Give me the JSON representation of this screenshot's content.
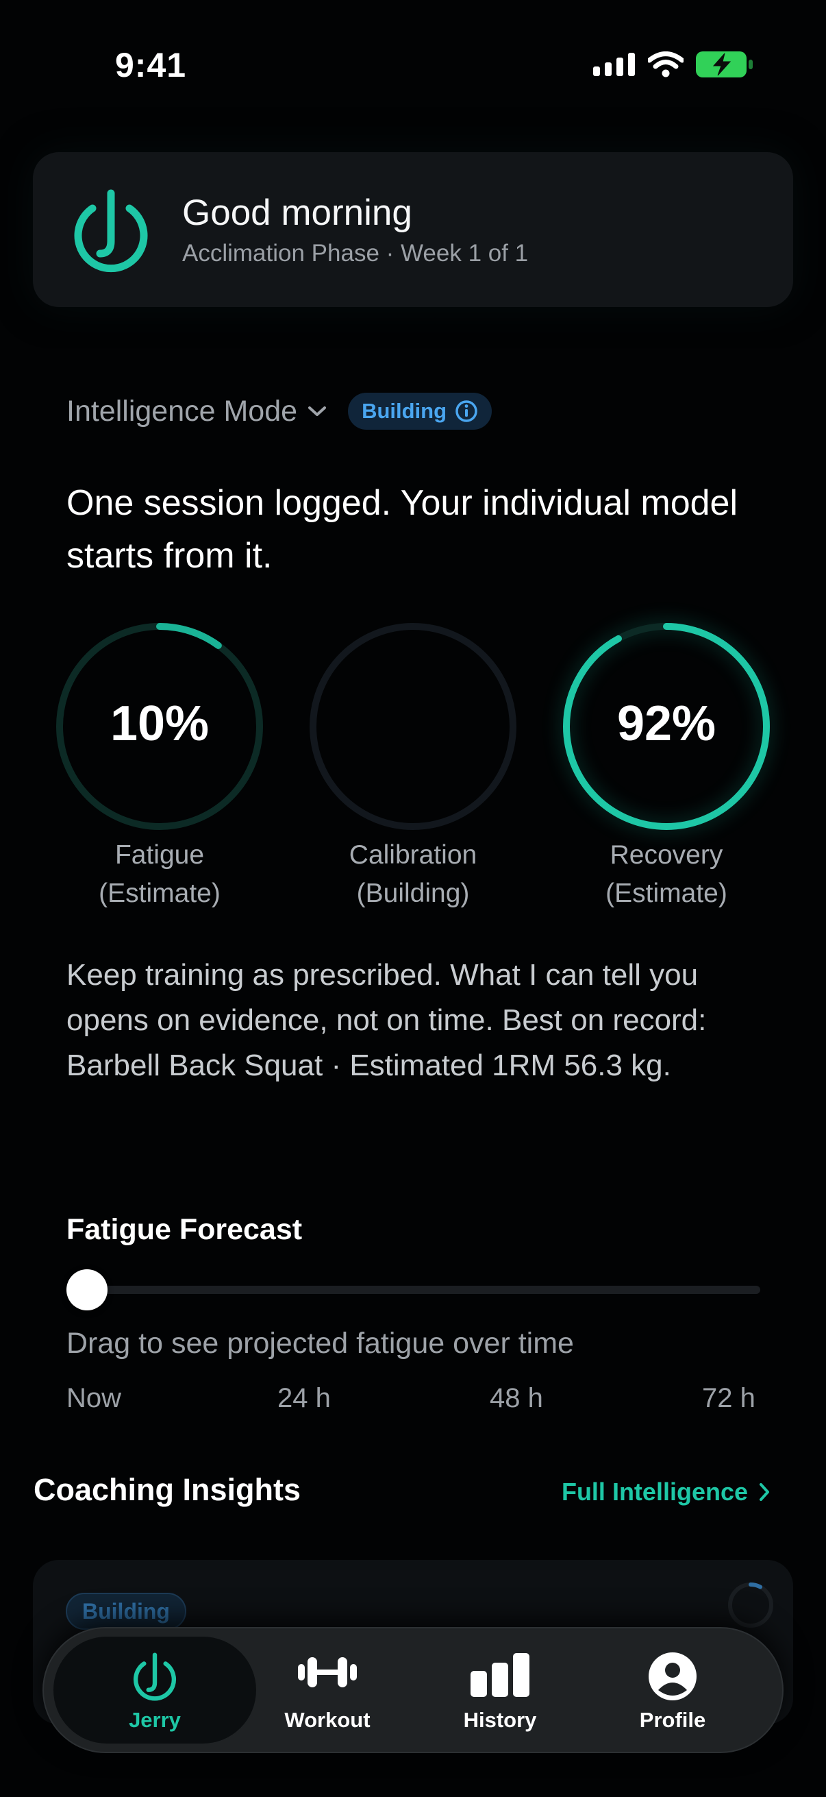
{
  "status_bar": {
    "time": "9:41"
  },
  "greeting": {
    "title": "Good morning",
    "subtitle": "Acclimation Phase · Week 1 of 1"
  },
  "intelligence_mode": {
    "label": "Intelligence Mode",
    "badge": "Building"
  },
  "headline": "One session logged. Your individual model starts from it.",
  "metrics": [
    {
      "value": "10%",
      "label": "Fatigue",
      "sublabel": "(Estimate)",
      "progress": 0.1
    },
    {
      "value": "",
      "label": "Calibration",
      "sublabel": "(Building)",
      "progress": 0
    },
    {
      "value": "92%",
      "label": "Recovery",
      "sublabel": "(Estimate)",
      "progress": 0.92
    }
  ],
  "body_text": "Keep training as prescribed. What I can tell you opens on evidence, not on time. Best on record: Barbell Back Squat · Estimated 1RM 56.3 kg.",
  "forecast": {
    "title": "Fatigue Forecast",
    "caption": "Drag to see projected fatigue over time",
    "slider_position": 0,
    "ticks": [
      "Now",
      "24 h",
      "48 h",
      "72 h"
    ]
  },
  "insights": {
    "title": "Coaching Insights",
    "link": "Full Intelligence",
    "card_badge": "Building"
  },
  "tabs": [
    {
      "label": "Jerry",
      "icon": "jerry-logo-icon",
      "active": true
    },
    {
      "label": "Workout",
      "icon": "dumbbell-icon",
      "active": false
    },
    {
      "label": "History",
      "icon": "bar-chart-icon",
      "active": false
    },
    {
      "label": "Profile",
      "icon": "person-icon",
      "active": false
    }
  ],
  "colors": {
    "accent": "#1ec7a6",
    "info_blue": "#4aa6f0",
    "card": "#121518",
    "background": "#020304"
  }
}
